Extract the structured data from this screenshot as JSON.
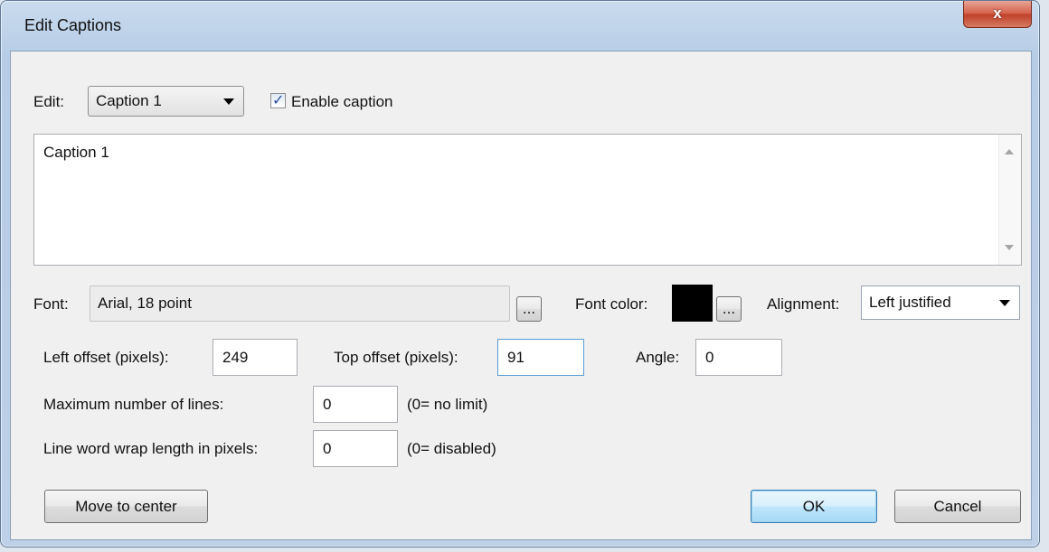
{
  "window": {
    "title": "Edit Captions",
    "close_label": "x"
  },
  "edit": {
    "label": "Edit:",
    "selected": "Caption 1"
  },
  "enable_caption": {
    "label": "Enable caption",
    "checked": true,
    "mark": "✓"
  },
  "caption_text": "Caption 1",
  "font": {
    "label": "Font:",
    "value": "Arial, 18 point",
    "browse_label": "..."
  },
  "font_color": {
    "label": "Font color:",
    "color": "#000000",
    "browse_label": "..."
  },
  "alignment": {
    "label": "Alignment:",
    "selected": "Left justified"
  },
  "left_offset": {
    "label": "Left offset (pixels):",
    "value": "249"
  },
  "top_offset": {
    "label": "Top offset (pixels):",
    "value": "91"
  },
  "angle": {
    "label": "Angle:",
    "value": "0"
  },
  "max_lines": {
    "label": "Maximum number of lines:",
    "value": "0",
    "hint": "(0= no limit)"
  },
  "wrap_length": {
    "label": "Line word wrap length in pixels:",
    "value": "0",
    "hint": "(0= disabled)"
  },
  "buttons": {
    "move_to_center": "Move to center",
    "ok": "OK",
    "cancel": "Cancel"
  }
}
